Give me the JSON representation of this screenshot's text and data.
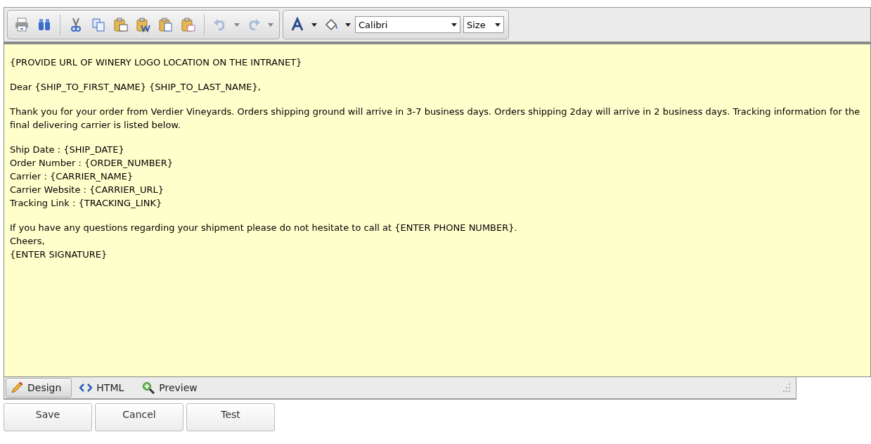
{
  "toolbar": {
    "groups": [
      {
        "items": [
          {
            "kind": "print"
          },
          {
            "kind": "find"
          },
          {
            "kind": "separator"
          },
          {
            "kind": "cut"
          },
          {
            "kind": "copy"
          },
          {
            "kind": "paste"
          },
          {
            "kind": "paste-word"
          },
          {
            "kind": "paste-text"
          },
          {
            "kind": "paste-html"
          },
          {
            "kind": "separator"
          },
          {
            "kind": "undo",
            "disabled": true
          },
          {
            "kind": "caret",
            "disabled": true
          },
          {
            "kind": "redo",
            "disabled": true
          },
          {
            "kind": "caret",
            "disabled": true
          }
        ]
      },
      {
        "items": [
          {
            "kind": "font-color"
          },
          {
            "kind": "caret",
            "disabled": false
          },
          {
            "kind": "highlight"
          },
          {
            "kind": "caret",
            "disabled": false
          },
          {
            "kind": "font-select",
            "value": "Calibri"
          },
          {
            "kind": "size-select",
            "value": "Size"
          }
        ]
      }
    ]
  },
  "editor": {
    "blocks": [
      [
        "{PROVIDE URL OF WINERY LOGO LOCATION ON THE INTRANET}"
      ],
      [
        "Dear {SHIP_TO_FIRST_NAME} {SHIP_TO_LAST_NAME},"
      ],
      [
        "Thank you for your order from Verdier Vineyards.  Orders shipping ground will arrive in 3-7 business days. Orders shipping 2day will arrive in 2 business days.  Tracking information for the final delivering carrier is listed below."
      ],
      [
        "Ship Date :  {SHIP_DATE}",
        "Order Number :   {ORDER_NUMBER}",
        "Carrier :  {CARRIER_NAME}",
        "Carrier Website :  {CARRIER_URL}",
        "Tracking Link :  {TRACKING_LINK}"
      ],
      [
        "If you have any questions regarding your shipment please do not hesitate to call at {ENTER PHONE NUMBER}.",
        "Cheers,",
        "{ENTER SIGNATURE}"
      ]
    ]
  },
  "modes": [
    {
      "kind": "design",
      "label": "Design",
      "selected": true
    },
    {
      "kind": "html",
      "label": "HTML",
      "selected": false
    },
    {
      "kind": "preview",
      "label": "Preview",
      "selected": false
    }
  ],
  "buttons": [
    "Save",
    "Cancel",
    "Test"
  ]
}
